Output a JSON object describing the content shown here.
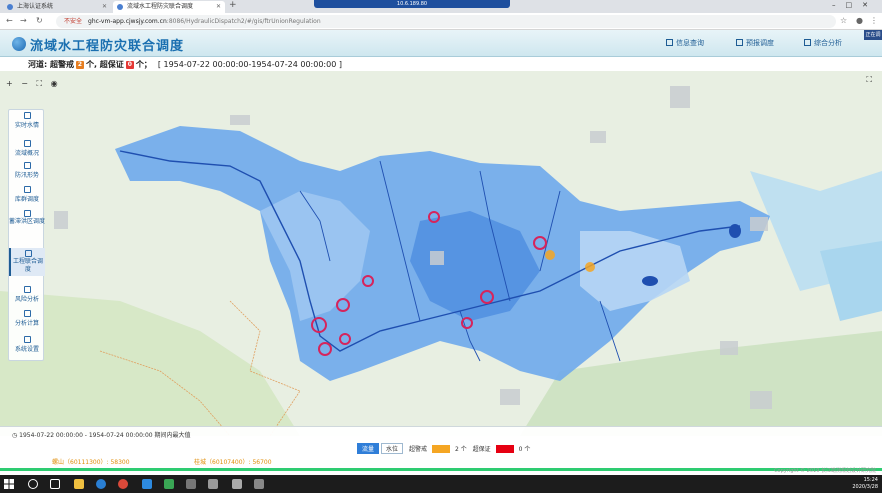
{
  "browser": {
    "tabs": [
      {
        "title": "上海认证系统"
      },
      {
        "title": "流域水工程防灾联合调度"
      }
    ],
    "ip_badge": "10.6.189.80",
    "address": {
      "security": "不安全",
      "host": "ghc-vm-app.cjwsjy.com.cn",
      "path": ":8086/HydraulicDispatch2/#/gis/ftrUnionRegulation"
    }
  },
  "app": {
    "title": "流域水工程防灾联合调度",
    "header_buttons": [
      "信息查询",
      "预报调度",
      "综合分析"
    ],
    "side_tab": "正在调"
  },
  "status": {
    "prefix": "河道: 超警戒",
    "warn_count": "2",
    "mid": "个, 超保证",
    "guar_count": "0",
    "suffix": "个；",
    "range": "[ 1954-07-22 00:00:00-1954-07-24 00:00:00 ]"
  },
  "map_tools": "+ − ⛶ ◉",
  "side_menu": [
    {
      "label": "实时水情",
      "icon": "waves-icon"
    },
    {
      "label": "流域概况",
      "icon": "house-icon"
    },
    {
      "label": "防汛形势",
      "icon": "chart-icon"
    },
    {
      "label": "库群调度",
      "icon": "network-icon"
    },
    {
      "label": "蓄滞洪区调度",
      "icon": "flag-icon"
    },
    {
      "label": "工程联合调度",
      "icon": "grid-icon",
      "active": true
    },
    {
      "label": "风险分析",
      "icon": "person-icon"
    },
    {
      "label": "分析计算",
      "icon": "bar-icon"
    },
    {
      "label": "系统设置",
      "icon": "database-icon"
    }
  ],
  "bottom": {
    "range_text": "1954-07-22 00:00:00 - 1954-07-24 00:00:00 期间内最大值",
    "legend_buttons": [
      "流量",
      "水位"
    ],
    "warn_label": "超警戒",
    "warn_count_text": "2 个",
    "guar_label": "超保证",
    "guar_count_text": "0 个",
    "station1": "螺山（60111300）: 58300",
    "station2": "桂城（60107400）: 56700",
    "copyright": "Copyright © 2019 长江勘测规划设计研究院"
  },
  "colors": {
    "warn": "#f5a623",
    "guar": "#e60012",
    "basin": "#5b9be6",
    "river": "#1f4fb0"
  },
  "taskbar": {
    "time": "15:24",
    "date": "2020/3/28"
  }
}
